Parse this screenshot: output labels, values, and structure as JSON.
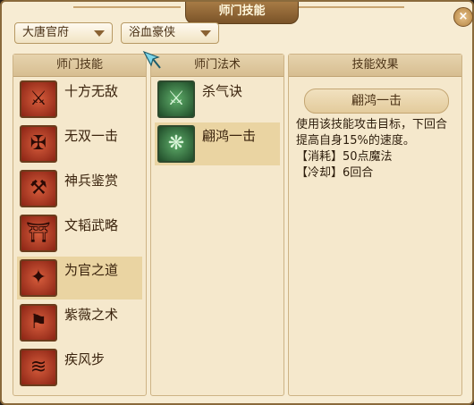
{
  "window": {
    "title": "师门技能",
    "close_glyph": "×"
  },
  "filters": {
    "faction": "大唐官府",
    "school": "浴血豪侠"
  },
  "left_panel": {
    "header": "师门技能",
    "items": [
      {
        "label": "十方无敌",
        "icon": "crossed-swords-icon",
        "glyph": "⚔"
      },
      {
        "label": "无双一击",
        "icon": "shield-crest-icon",
        "glyph": "✠"
      },
      {
        "label": "神兵鉴赏",
        "icon": "weapon-appraisal-icon",
        "glyph": "⚒"
      },
      {
        "label": "文韬武略",
        "icon": "gate-icon",
        "glyph": "⛩"
      },
      {
        "label": "为官之道",
        "icon": "official-seal-icon",
        "glyph": "✦"
      },
      {
        "label": "紫薇之术",
        "icon": "banner-icon",
        "glyph": "⚑"
      },
      {
        "label": "疾风步",
        "icon": "wind-step-icon",
        "glyph": "≋"
      }
    ],
    "selected_index": 4
  },
  "middle_panel": {
    "header": "师门法术",
    "items": [
      {
        "label": "杀气诀",
        "icon": "killing-aura-icon",
        "glyph": "⚔"
      },
      {
        "label": "翩鸿一击",
        "icon": "swan-strike-icon",
        "glyph": "❋"
      }
    ],
    "selected_index": 1
  },
  "right_panel": {
    "header": "技能效果",
    "skill_name": "翩鸿一击",
    "description_lines": [
      "使用该技能攻击目标，下回合",
      "提高自身15%的速度。",
      "【消耗】50点魔法",
      "【冷却】6回合"
    ]
  },
  "colors": {
    "background": "#f7ecd3",
    "selected_row": "#ead4a2",
    "title_bar": "#8a6233",
    "skill_icon_red": "#b53a22",
    "spell_icon_green": "#2f6b3a"
  }
}
